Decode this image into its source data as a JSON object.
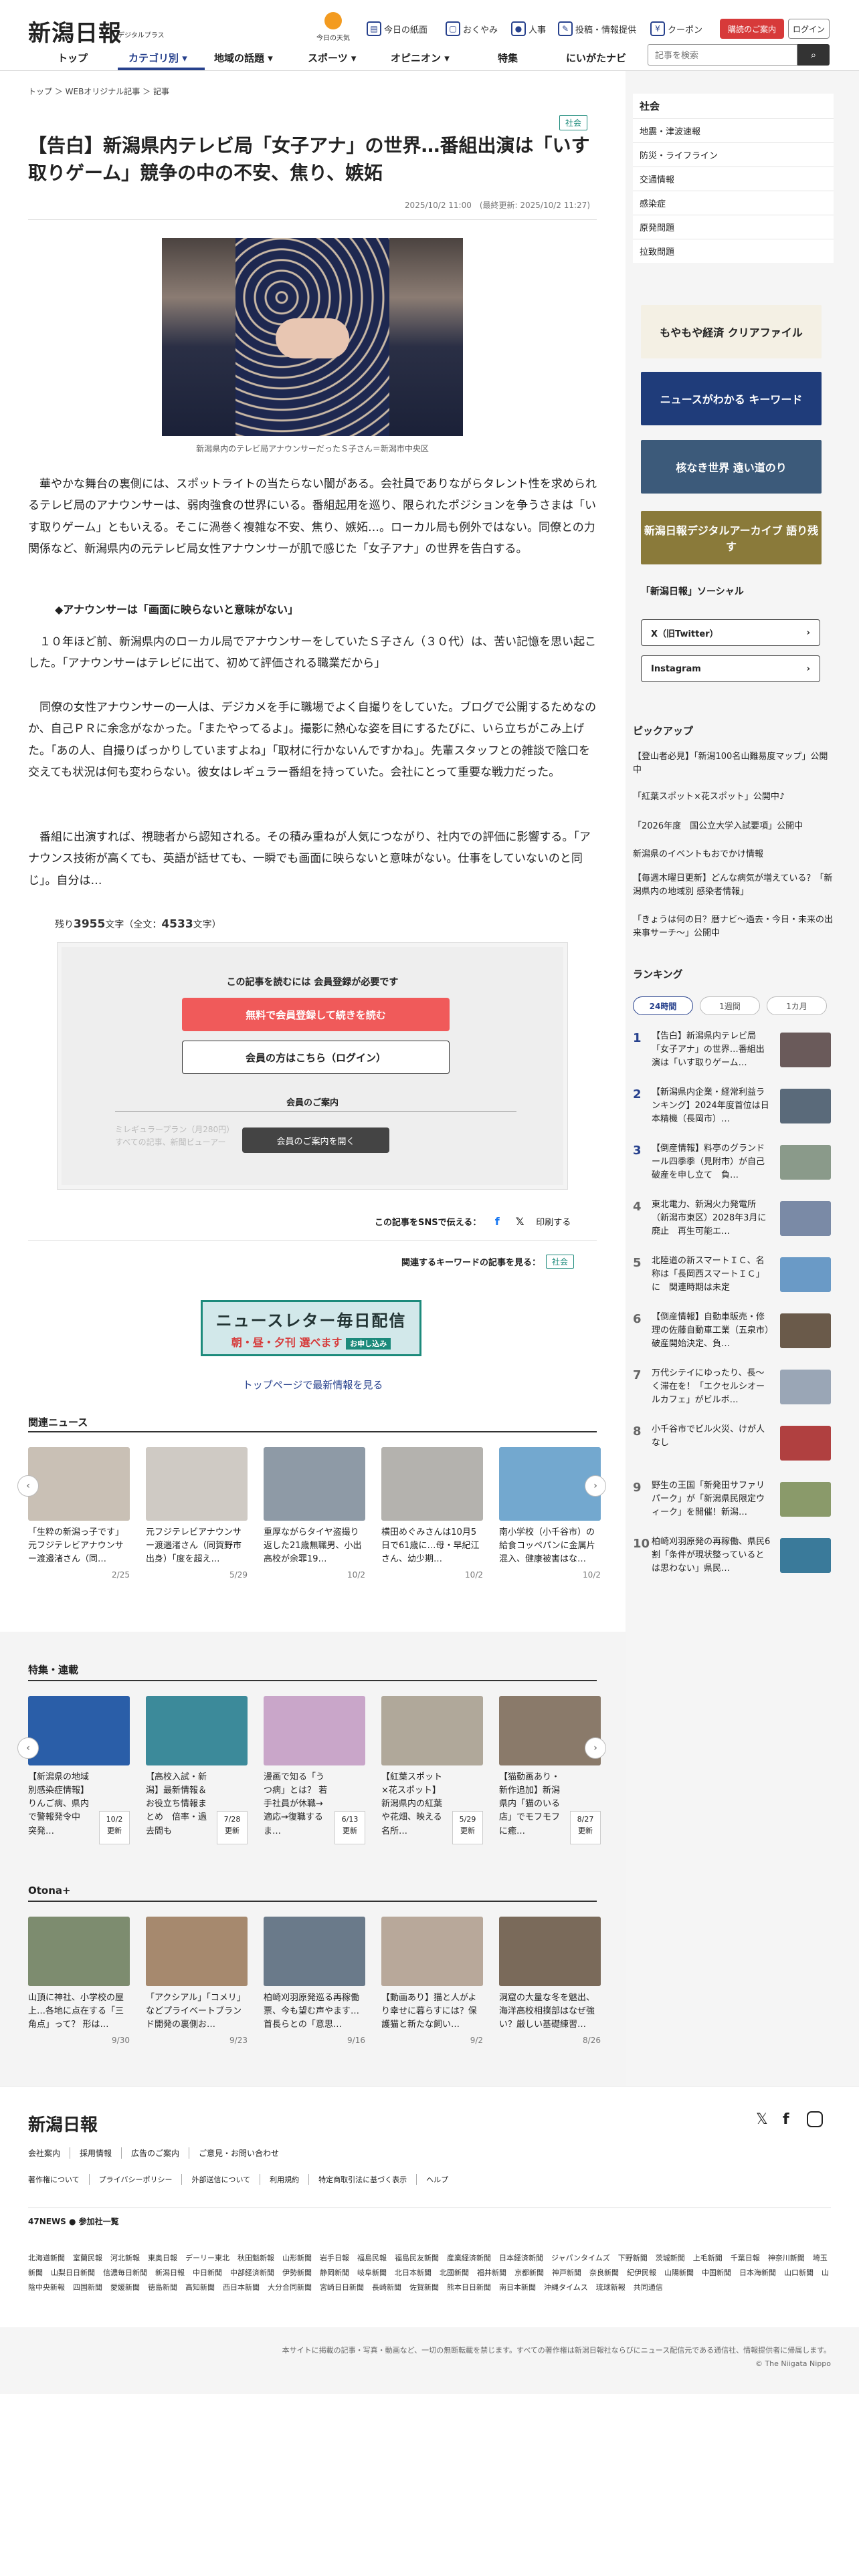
{
  "header": {
    "logo": "新潟日報",
    "logo_sub": "デジタルプラス",
    "fortune": "今日の天気",
    "util": [
      {
        "icon": "newspaper-icon",
        "label": "今日の紙面"
      },
      {
        "icon": "obituary-icon",
        "label": "おくやみ"
      },
      {
        "icon": "person-icon",
        "label": "人事"
      },
      {
        "icon": "post-icon",
        "label": "投稿・情報提供"
      },
      {
        "icon": "coupon-icon",
        "label": "クーポン"
      }
    ],
    "register": "購読のご案内",
    "login": "ログイン",
    "nav": [
      "トップ",
      "カテゴリ別 ▾",
      "地域の話題 ▾",
      "スポーツ ▾",
      "オピニオン ▾",
      "特集",
      "にいがたナビ"
    ],
    "search_placeholder": "記事を検索"
  },
  "breadcrumb": "トップ ＞ WEBオリジナル記事 ＞ 記事",
  "article": {
    "tag": "社会",
    "title": "【告白】新潟県内テレビ局「女子アナ」の世界…番組出演は「いす取りゲーム」競争の中の不安、焦り、嫉妬",
    "date": "2025/10/2 11:00　(最終更新: 2025/10/2 11:27)",
    "caption": "新潟県内のテレビ局アナウンサーだったＳ子さん＝新潟市中央区",
    "p1": "華やかな舞台の裏側には、スポットライトの当たらない闇がある。会社員でありながらタレント性を求められるテレビ局のアナウンサーは、弱肉強食の世界にいる。番組起用を巡り、限られたポジションを争うさまは「いす取りゲーム」ともいえる。そこに渦巻く複雑な不安、焦り、嫉妬…。ローカル局も例外ではない。同僚との力関係など、新潟県内の元テレビ局女性アナウンサーが肌で感じた「女子アナ」の世界を告白する。",
    "subhead": "◆アナウンサーは「画面に映らないと意味がない」",
    "p2": "１０年ほど前、新潟県内のローカル局でアナウンサーをしていたＳ子さん（３０代）は、苦い記憶を思い起こした。「アナウンサーはテレビに出て、初めて評価される職業だから」",
    "p3": "同僚の女性アナウンサーの一人は、デジカメを手に職場でよく自撮りをしていた。ブログで公開するためなのか、自己ＰＲに余念がなかった。「またやってるよ」。撮影に熱心な姿を目にするたびに、いら立ちがこみ上げた。「あの人、自撮りばっかりしていますよね」「取材に行かないんですかね」。先輩スタッフとの雑談で陰口を交えても状況は何も変わらない。彼女はレギュラー番組を持っていた。会社にとって重要な戦力だった。",
    "p4": "番組に出演すれば、視聴者から認知される。その積み重ねが人気につながり、社内での評価に影響する。「アナウンス技術が高くても、英語が話せても、一瞬でも画面に映らないと意味がない。仕事をしていないのと同じ」。自分は…",
    "remaining_prefix": "残り",
    "remaining": "3955",
    "remaining_mid": "文字（全文：",
    "total": "4533",
    "remaining_suffix": "文字）"
  },
  "paywall": {
    "head": "この記事を読むには 会員登録が必要です",
    "free": "無料で会員登録して続きを読む",
    "login": "会員の方はこちら（ログイン）",
    "guide": "会員のご案内",
    "faded": "ミレギュラープラン（月280円）\nすべての記事、新聞ビューアー",
    "open": "会員のご案内を開く"
  },
  "share": {
    "label": "この記事をSNSで伝える：",
    "print": "印刷する"
  },
  "keywords": {
    "label": "関連するキーワードの記事を見る：",
    "tag": "社会"
  },
  "newsletter": {
    "l1": "ニュースレター毎日配信",
    "l2": "朝・昼・夕刊 選べます",
    "l3": "お申し込み"
  },
  "toplink": "トップページで最新情報を見る",
  "related": {
    "title": "関連ニュース",
    "items": [
      {
        "text": "「生粋の新潟っ子です」元フジテレビアナウンサー渡邉渚さん（同…",
        "date": "2/25",
        "color": "#c9c0b5"
      },
      {
        "text": "元フジテレビアナウンサー渡邉渚さん（同賀野市出身）「度を超え…",
        "date": "5/29",
        "color": "#cfcac4"
      },
      {
        "text": "重厚ながらタイヤ盗撮り返した21歳無職男、小出高校が余罪19…",
        "date": "10/2",
        "color": "#8e9aa6"
      },
      {
        "text": "横田めぐみさんは10月5日で61歳に…母・早紀江さん、幼少期…",
        "date": "10/2",
        "color": "#b4b2ae"
      },
      {
        "text": "南小学校（小千谷市）の給食コッペパンに金属片混入、健康被害はな…",
        "date": "10/2",
        "color": "#73a8cf"
      }
    ]
  },
  "features": {
    "title": "特集・連載",
    "items": [
      {
        "text": "【新潟県の地域別感染症情報】りんご病、県内で警報発令中　突発…",
        "badge": "10/2\n更新",
        "color": "#2a5ea8"
      },
      {
        "text": "【高校入試・新潟】最新情報＆お役立ち情報まとめ　倍率・過去問も",
        "badge": "7/28\n更新",
        "color": "#3c8a9a"
      },
      {
        "text": "漫画で知る「うつ病」とは？ 若手社員が休職→適応→復職する ま…",
        "badge": "6/13\n更新",
        "color": "#c9a6c9"
      },
      {
        "text": "【紅葉スポット×花スポット】新潟県内の紅葉や花畑、映える名所…",
        "badge": "5/29\n更新",
        "color": "#b0a89a"
      },
      {
        "text": "【猫動画あり・新作追加】新潟県内「猫のいる店」でモフモフに癒…",
        "badge": "8/27\n更新",
        "color": "#8a7a6a"
      }
    ]
  },
  "otona": {
    "title": "Otona+",
    "items": [
      {
        "text": "山頂に神社、小学校の屋上…各地に点在する「三角点」って？ 形は…",
        "date": "9/30",
        "color": "#7d8c6f"
      },
      {
        "text": "「アクシアル」「コメリ」などプライベートブランド開発の裏側お…",
        "date": "9/23",
        "color": "#a6896e"
      },
      {
        "text": "柏崎刈羽原発巡る再稼働票、今も望む声やます…首長らとの「意思…",
        "date": "9/16",
        "color": "#6a7a8a"
      },
      {
        "text": "【動画あり】猫と人がより幸せに暮らすには？保護猫と新たな飼い…",
        "date": "9/2",
        "color": "#b8a89a"
      },
      {
        "text": "洞窟の大量な冬を魅出、海洋高校相撲部はなぜ強い？厳しい基礎練習…",
        "date": "8/26",
        "color": "#7a6a5a"
      }
    ]
  },
  "sidebar": {
    "category_title": "社会",
    "categories": [
      "地震・津波速報",
      "防災・ライフライン",
      "交通情報",
      "感染症",
      "原発問題",
      "拉致問題"
    ],
    "banners": [
      {
        "label": "もやもや経済 クリアファイル",
        "color": "#f4f0e4"
      },
      {
        "label": "ニュースがわかる キーワード",
        "color": "#1f3c7a"
      },
      {
        "label": "核なき世界 遠い道のり",
        "color": "#3c5a7a"
      },
      {
        "label": "新潟日報デジタルアーカイブ 語り残す",
        "color": "#8a7a3a"
      }
    ],
    "social_title": "「新潟日報」ソーシャル",
    "social": [
      "X（旧Twitter）",
      "Instagram"
    ],
    "pickup_title": "ピックアップ",
    "pickup": [
      "【登山者必見】「新潟100名山難易度マップ」公開中",
      "「紅葉スポット×花スポット」公開中♪",
      "「2026年度　国公立大学入試要項」公開中",
      "新潟県のイベントもおでかけ情報",
      "【毎週木曜日更新】どんな病気が増えている？「新潟県内の地域別 感染者情報」",
      "「きょうは何の日？暦ナビ～過去・今日・未来の出来事サーチ～」公開中"
    ],
    "ranking_title": "ランキング",
    "tabs": [
      "24時間",
      "1週間",
      "1カ月"
    ],
    "ranking": [
      {
        "n": "1",
        "t": "【告白】新潟県内テレビ局「女子アナ」の世界…番組出演は「いす取りゲーム…",
        "color": "#6a5a5a"
      },
      {
        "n": "2",
        "t": "【新潟県内企業・経常利益ランキング】2024年度首位は日本精機（長岡市）…",
        "color": "#5a6a7a"
      },
      {
        "n": "3",
        "t": "【倒産情報】料亭のグランドール四季季（見附市）が自己破産を申し立て　負…",
        "color": "#8a9a8a"
      },
      {
        "n": "4",
        "t": "東北電力、新潟火力発電所（新潟市東区）2028年3月に廃止　再生可能エ…",
        "color": "#7a8aa6"
      },
      {
        "n": "5",
        "t": "北陸道の新スマートＩＣ、名称は「長岡西スマートＩＣ」に　関連時期は未定",
        "color": "#6a9ac6"
      },
      {
        "n": "6",
        "t": "【倒産情報】自動車販売・修理の佐藤自動車工業（五泉市）破産開始決定、負…",
        "color": "#6a5a4a"
      },
      {
        "n": "7",
        "t": "万代シテイにゆったり、長～く滞在を！「エクセルシオールカフェ」がビルボ…",
        "color": "#9aa6b6"
      },
      {
        "n": "8",
        "t": "小千谷市でビル火災、けが人なし",
        "color": "#b04040"
      },
      {
        "n": "9",
        "t": "野生の王国「新発田サファリパーク」が「新潟県民限定ウィーク」を開催！新潟…",
        "color": "#8a9a6a"
      },
      {
        "n": "10",
        "t": "柏崎刈羽原発の再稼働、県民6割「条件が現状整っているとは思わない」県民…",
        "color": "#3a7a9a"
      }
    ]
  },
  "footer": {
    "logo": "新潟日報",
    "links1": [
      "会社案内",
      "採用情報",
      "広告のご案内",
      "ご意見・お問い合わせ"
    ],
    "links2": [
      "著作権について",
      "プライバシーポリシー",
      "外部送信について",
      "利用規約",
      "特定商取引法に基づく表示",
      "ヘルプ"
    ],
    "news47_title": "47NEWS ● 参加社一覧",
    "news47": [
      "北海道新聞",
      "室蘭民報",
      "河北新報",
      "東奥日報",
      "デーリー東北",
      "秋田魁新報",
      "山形新聞",
      "岩手日報",
      "福島民報",
      "福島民友新聞",
      "産業経済新聞",
      "日本経済新聞",
      "ジャパンタイムズ",
      "下野新聞",
      "茨城新聞",
      "上毛新聞",
      "千葉日報",
      "神奈川新聞",
      "埼玉新聞",
      "山梨日日新聞",
      "信濃毎日新聞",
      "新潟日報",
      "中日新聞",
      "中部経済新聞",
      "伊勢新聞",
      "静岡新聞",
      "岐阜新聞",
      "北日本新聞",
      "北國新聞",
      "福井新聞",
      "京都新聞",
      "神戸新聞",
      "奈良新聞",
      "紀伊民報",
      "山陽新聞",
      "中国新聞",
      "日本海新聞",
      "山口新聞",
      "山陰中央新報",
      "四国新聞",
      "愛媛新聞",
      "徳島新聞",
      "高知新聞",
      "西日本新聞",
      "大分合同新聞",
      "宮崎日日新聞",
      "長崎新聞",
      "佐賀新聞",
      "熊本日日新聞",
      "南日本新聞",
      "沖縄タイムス",
      "琉球新報",
      "共同通信"
    ],
    "copyright_note": "本サイトに掲載の記事・写真・動画など、一切の無断転載を禁じます。すべての著作権は新潟日報社ならびにニュース配信元である通信社、情報提供者に帰属します。",
    "copyright": "© The Niigata Nippo"
  }
}
